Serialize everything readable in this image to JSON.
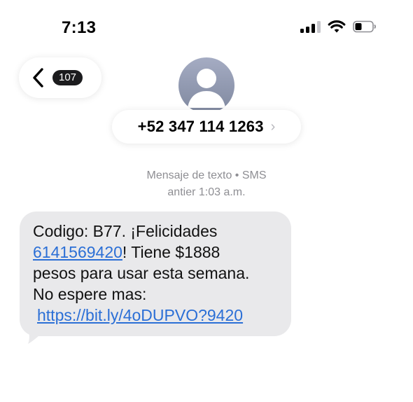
{
  "status_bar": {
    "time": "7:13",
    "icons": [
      "cellular-signal-icon",
      "wifi-icon",
      "battery-icon"
    ]
  },
  "header": {
    "back_icon": "chevron-left-icon",
    "unread_count": "107",
    "avatar_icon": "person-silhouette-icon",
    "contact_number": "+52 347 114 1263",
    "contact_chevron": "›"
  },
  "conversation": {
    "meta_type": "Mensaje de texto • SMS",
    "meta_time": "antier 1:03 a.m."
  },
  "message": {
    "text_1": "Codigo: B77. ¡Felicidades",
    "phone_link": "6141569420",
    "text_2": "! Tiene $1888",
    "text_3": "pesos para usar esta semana.",
    "text_4": "No espere mas:",
    "url_link": "https://bit.ly/4oDUPVO?9420"
  },
  "colors": {
    "bubble_bg": "#e9e9eb",
    "link": "#2b6fd6",
    "meta_text": "#8e8e93"
  }
}
